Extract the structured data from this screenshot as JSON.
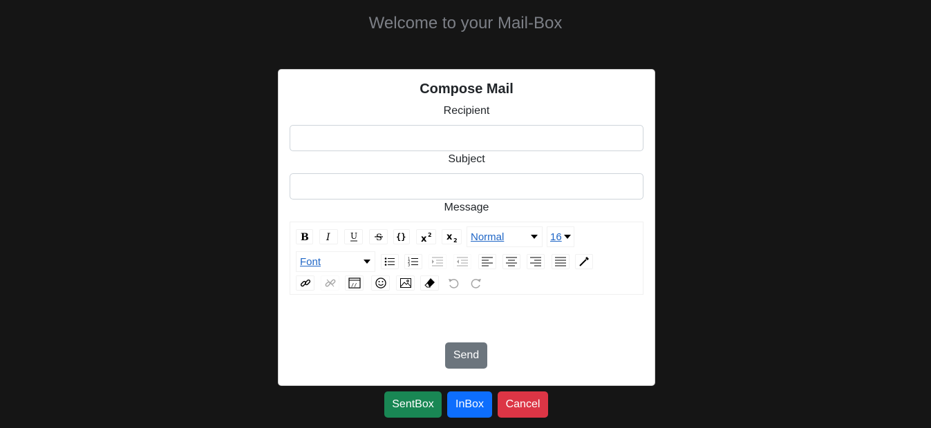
{
  "header": {
    "title": "Welcome to your Mail-Box"
  },
  "compose": {
    "title": "Compose Mail",
    "recipient_label": "Recipient",
    "recipient_value": "",
    "subject_label": "Subject",
    "subject_value": "",
    "message_label": "Message",
    "send_label": "Send"
  },
  "editor_toolbar": {
    "block_type": "Normal",
    "font_size": "16",
    "font_family": "Font",
    "tools": [
      "bold-icon",
      "italic-icon",
      "underline-icon",
      "strikethrough-icon",
      "code-icon",
      "superscript-icon",
      "subscript-icon",
      "unordered-list-icon",
      "ordered-list-icon",
      "indent-icon",
      "outdent-icon",
      "align-left-icon",
      "align-center-icon",
      "align-right-icon",
      "align-justify-icon",
      "color-picker-icon",
      "link-icon",
      "unlink-icon",
      "embed-icon",
      "emoji-icon",
      "image-icon",
      "eraser-icon",
      "undo-icon",
      "redo-icon"
    ]
  },
  "nav": {
    "sentbox_label": "SentBox",
    "inbox_label": "InBox",
    "cancel_label": "Cancel"
  },
  "colors": {
    "background": "#151515",
    "send": "#6c757d",
    "sentbox": "#198754",
    "inbox": "#0d6efd",
    "cancel": "#dc3545",
    "link": "#1f66c6"
  }
}
